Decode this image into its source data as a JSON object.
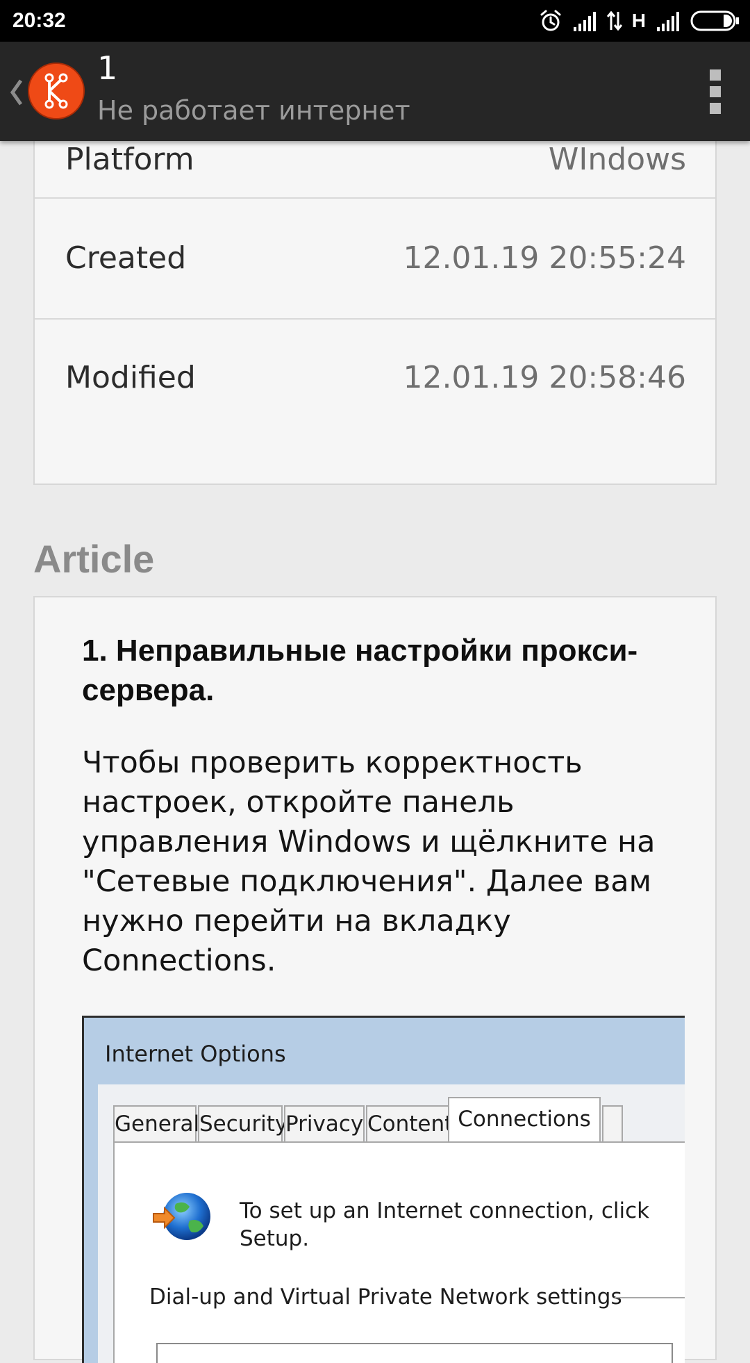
{
  "status_bar": {
    "time": "20:32",
    "network_type": "H",
    "icons": [
      "alarm-icon",
      "signal-icon",
      "data-transfer-icon",
      "signal-icon",
      "battery-icon"
    ]
  },
  "action_bar": {
    "title": "1",
    "subtitle": "Не работает интернет",
    "logo_color": "#ef4a16",
    "background_color": "#262626"
  },
  "properties": [
    {
      "label": "Platform",
      "value": "WIndows"
    },
    {
      "label": "Created",
      "value": "12.01.19 20:55:24"
    },
    {
      "label": "Modified",
      "value": "12.01.19 20:58:46"
    }
  ],
  "article": {
    "section_title": "Article",
    "heading": "1. Неправильные настройки прокси-сервера.",
    "paragraph": "Чтобы проверить корректность настроек, откройте панель управления Windows и щёлкните на \"Сетевые подключения\". Далее вам нужно перейти на вкладку Connections.",
    "screenshot": {
      "window_title": "Internet Options",
      "tabs": [
        "General",
        "Security",
        "Privacy",
        "Content",
        "Connections"
      ],
      "active_tab": "Connections",
      "setup_text": "To set up an Internet connection, click Setup.",
      "group_label": "Dial-up and Virtual Private Network settings"
    }
  }
}
